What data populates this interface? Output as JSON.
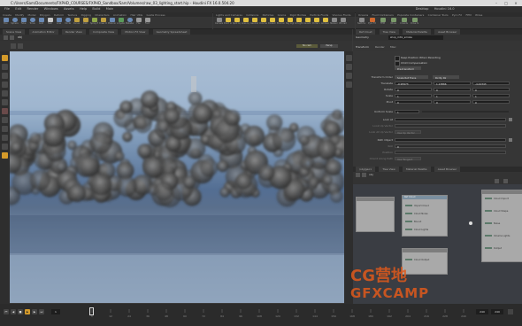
{
  "window": {
    "title": "C:/Users/Sam/Documents/FXPHD_COURSES/FXPHD_Sandbox/Sam/Volumes/raw_03_lighting_start.hip - Houdini FX 16.0.504.20",
    "controls": [
      "–",
      "□",
      "×"
    ]
  },
  "menu": [
    "File",
    "Edit",
    "Render",
    "Windows",
    "Assets",
    "Help",
    "Build",
    "Main",
    "Desktop",
    "Houdini 16.0"
  ],
  "shelf": {
    "tabs": [
      "Create",
      "Modify",
      "Model",
      "Polygon",
      "Deform",
      "Texture",
      "Rigging",
      "Characters",
      "Animation",
      "Hair Utils",
      "Guide Process",
      "Terrain FX",
      "Cloud FX",
      "Volume",
      "Lights and Cameras",
      "Collisions",
      "Particles",
      "Grains",
      "Rigid Bodies",
      "Particle Fluids",
      "Viscous Fluids",
      "Oceans",
      "Fluid Containers",
      "Populate Containers",
      "Container Tools",
      "Pyro FX",
      "FEM",
      "Wires",
      "Crowds",
      "Drive Simulation"
    ],
    "tools": [
      "Box",
      "Sphere",
      "Tube",
      "Torus",
      "Grid",
      "Null",
      "Line",
      "Circle",
      "Curve",
      "Path",
      "Spray Paint",
      "Draw Curve",
      "Platonic",
      "L-System",
      "Metaball",
      "File",
      "Font",
      "Camera",
      "Point Light",
      "Spot Light",
      "Area Light",
      "Geometry Light",
      "Volume Light",
      "Distant Light",
      "Environment Light",
      "Sky Light",
      "GI Light",
      "Caustic Light",
      "Portal Light",
      "Ambient Light",
      "Stereo Camera",
      "VR Camera",
      "Switcher"
    ]
  },
  "viewport": {
    "tabs": [
      "Scene View",
      "Animation Editor",
      "Render View",
      "Composite View",
      "Motion FX View",
      "Geometry Spreadsheet"
    ],
    "path": "obj",
    "camera_label": "No cam",
    "display_label": "Persp"
  },
  "params": {
    "tabs": [
      "Ref Cloud",
      "Tree View",
      "Material Palette",
      "Asset Browser"
    ],
    "node_type": "Geometry",
    "node_name": "shop_mtlx_smoke",
    "subtabs": [
      "Transform",
      "Render",
      "Misc"
    ],
    "rows": [
      {
        "label": "Keep Position When Parenting",
        "type": "check"
      },
      {
        "label": "Child Compensation",
        "type": "check"
      },
      {
        "label": "Pre-transform",
        "value": "Pre-transform"
      },
      {
        "label": "Transform Order",
        "value": "Scale Rot Trans",
        "value2": "Rx Ry Rz"
      },
      {
        "label": "Translate",
        "values": [
          "-0.95973",
          "1.13866",
          "-4.42343"
        ]
      },
      {
        "label": "Rotate",
        "values": [
          "0",
          "0",
          "0"
        ]
      },
      {
        "label": "Scale",
        "values": [
          "1",
          "1",
          "1"
        ]
      },
      {
        "label": "Pivot",
        "values": [
          "0",
          "0",
          "0"
        ]
      },
      {
        "label": "Uniform Scale",
        "value": "1"
      },
      {
        "label": "Look At",
        "value": ""
      },
      {
        "label": "Look Up Vector",
        "value": ""
      },
      {
        "label": "Look At Up Vector",
        "value": "Use Up Vector"
      },
      {
        "label": "Path Object",
        "value": ""
      },
      {
        "label": "Roll",
        "value": "0"
      },
      {
        "label": "Position",
        "value": ""
      },
      {
        "label": "Orient Along Path",
        "value": "Use Tangent"
      }
    ]
  },
  "network": {
    "tabs": [
      "/obj/geo1",
      "Tree View",
      "Material Palette",
      "Asset Browser"
    ],
    "path": "obj",
    "nodes": [
      {
        "title": "",
        "items": []
      },
      {
        "title": "Ref Cloud",
        "items": [
          "Import Cloud",
          "Cloud Noise",
          "Bound",
          "Cloud Lights"
        ]
      },
      {
        "title": "",
        "items": [
          "Cloud Output"
        ]
      },
      {
        "title": "",
        "items": [
          "Cloud Import",
          "Cloud Shape",
          "Noise",
          "Volume Lights",
          "Output"
        ]
      }
    ]
  },
  "timeline": {
    "start_frame": "1",
    "current_frame": "1",
    "end_frame": "240",
    "end_frame2": "240",
    "ticks": [
      "1",
      "12",
      "24",
      "36",
      "48",
      "60",
      "72",
      "84",
      "96",
      "108",
      "120",
      "132",
      "144",
      "156",
      "168",
      "180",
      "192",
      "204",
      "216",
      "228",
      "240"
    ]
  },
  "watermark": {
    "line1": "CG营地",
    "line2": "GFXCAMP"
  },
  "colors": {
    "accent": "#e0a030",
    "watermark": "#e05a1c",
    "viewport_sky": "#a9bdd4",
    "viewport_ground": "#5a6f8c"
  }
}
